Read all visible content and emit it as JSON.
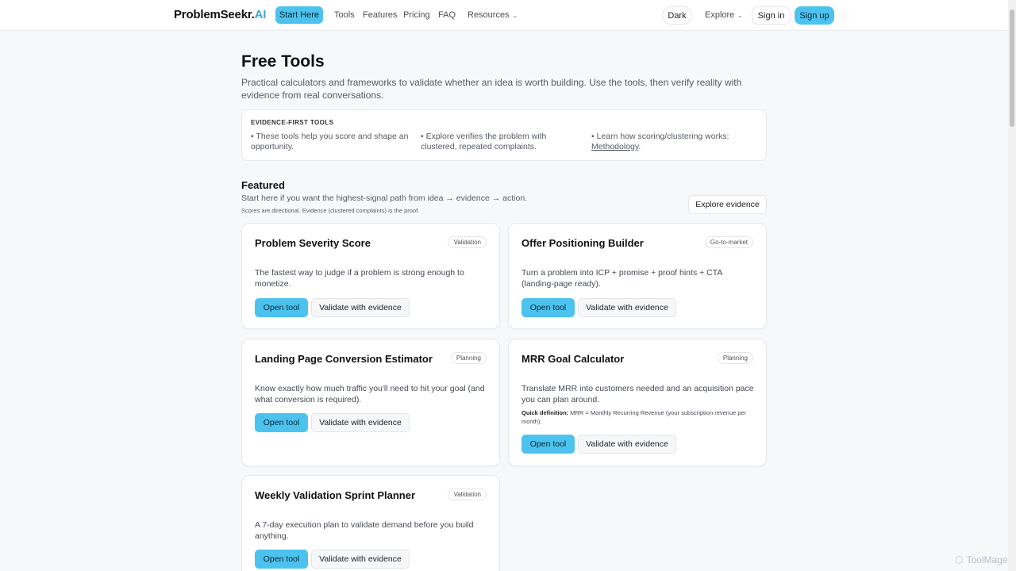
{
  "header": {
    "brand_main": "ProblemSeekr.",
    "brand_ai": "AI",
    "start_here": "Start Here",
    "nav": [
      "Tools",
      "Features",
      "Pricing",
      "FAQ"
    ],
    "resources": "Resources",
    "dark": "Dark",
    "explore": "Explore",
    "sign_in": "Sign in",
    "sign_up": "Sign up"
  },
  "page": {
    "title": "Free Tools",
    "intro": "Practical calculators and frameworks to validate whether an idea is worth building. Use the tools, then verify reality with evidence from real conversations."
  },
  "info": {
    "label": "EVIDENCE-FIRST TOOLS",
    "col1": "• These tools help you score and shape an opportunity.",
    "col2": "• Explore verifies the problem with clustered, repeated complaints.",
    "col3_prefix": "• Learn how scoring/clustering works: ",
    "col3_link": "Methodology",
    "col3_suffix": "."
  },
  "featured": {
    "title": "Featured",
    "subtitle": "Start here if you want the highest-signal path from idea → evidence → action.",
    "note": "Scores are directional. Evidence (clustered complaints) is the proof.",
    "explore_button": "Explore evidence"
  },
  "cards": [
    {
      "title": "Problem Severity Score",
      "tag": "Validation",
      "description": "The fastest way to judge if a problem is strong enough to monetize.",
      "open": "Open tool",
      "validate": "Validate with evidence"
    },
    {
      "title": "Offer Positioning Builder",
      "tag": "Go-to-market",
      "description": "Turn a problem into ICP + promise + proof hints + CTA (landing-page ready).",
      "open": "Open tool",
      "validate": "Validate with evidence"
    },
    {
      "title": "Landing Page Conversion Estimator",
      "tag": "Planning",
      "description": "Know exactly how much traffic you'll need to hit your goal (and what conversion is required).",
      "open": "Open tool",
      "validate": "Validate with evidence"
    },
    {
      "title": "MRR Goal Calculator",
      "tag": "Planning",
      "description": "Translate MRR into customers needed and an acquisition pace you can plan around.",
      "quick_def_label": "Quick definition:",
      "quick_def_text": " MRR = Monthly Recurring Revenue (your subscription revenue per month).",
      "open": "Open tool",
      "validate": "Validate with evidence"
    },
    {
      "title": "Weekly Validation Sprint Planner",
      "tag": "Validation",
      "description": "A 7-day execution plan to validate demand before you build anything.",
      "open": "Open tool",
      "validate": "Validate with evidence"
    }
  ],
  "watermark": "ToolMage",
  "colors": {
    "accent": "#4cc3ee",
    "background": "#f7f8fa"
  }
}
